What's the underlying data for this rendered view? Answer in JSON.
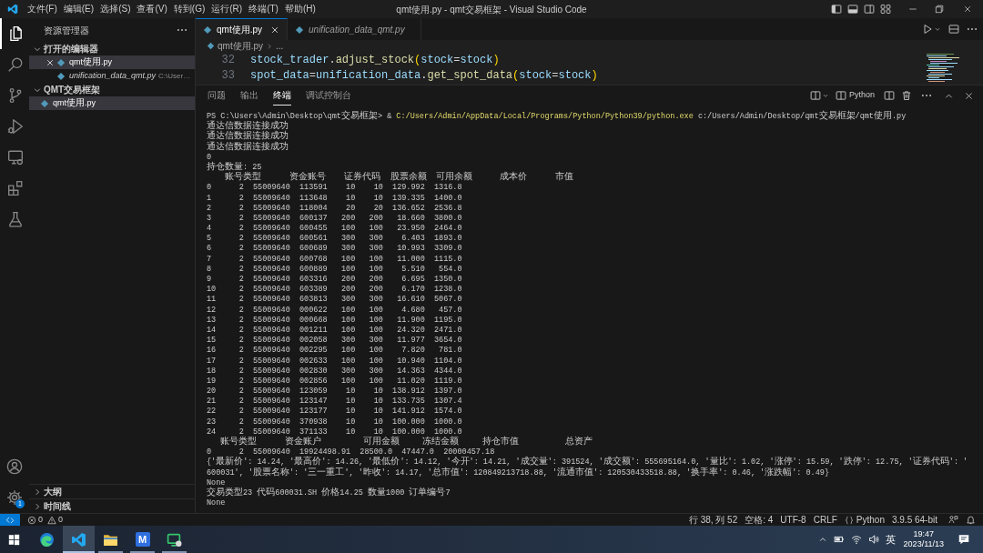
{
  "title_bar": {
    "menu": [
      "文件(F)",
      "编辑(E)",
      "选择(S)",
      "查看(V)",
      "转到(G)",
      "运行(R)",
      "终端(T)",
      "帮助(H)"
    ],
    "title": "qmt使用.py - qmt交易框架 - Visual Studio Code",
    "layout_toggles": [
      {
        "kind": "sidebar",
        "on": true
      },
      {
        "kind": "panel",
        "on": true
      },
      {
        "kind": "secondary",
        "on": false
      },
      {
        "kind": "customize"
      }
    ]
  },
  "activity_bar": {
    "items": [
      {
        "kind": "explorer",
        "selected": true
      },
      {
        "kind": "search",
        "selected": false
      },
      {
        "kind": "source_control",
        "selected": false
      },
      {
        "kind": "run",
        "selected": false
      },
      {
        "kind": "remote",
        "selected": false
      },
      {
        "kind": "extensions",
        "selected": false
      },
      {
        "kind": "testing",
        "selected": false
      }
    ],
    "bottom": [
      {
        "kind": "account"
      },
      {
        "kind": "settings",
        "badge": "1"
      }
    ]
  },
  "sidebar": {
    "title": "资源管理器",
    "sections": [
      {
        "title": "打开的编辑器",
        "expanded": true,
        "items": [
          {
            "label": "qmt使用.py",
            "selected": true,
            "preview": false,
            "close": true
          },
          {
            "label": "unification_data_qmt.py",
            "description": "C:\\User…",
            "selected": false,
            "preview": true,
            "close": false
          }
        ]
      },
      {
        "title": "QMT交易框架",
        "expanded": true,
        "items": [
          {
            "label": "qmt使用.py",
            "selected": true,
            "preview": false
          }
        ]
      },
      {
        "title": "大纲",
        "expanded": false
      },
      {
        "title": "时间线",
        "expanded": false
      }
    ]
  },
  "editor": {
    "tabs": [
      {
        "label": "qmt使用.py",
        "selected": true,
        "preview": false
      },
      {
        "label": "unification_data_qmt.py",
        "selected": false,
        "preview": true
      }
    ],
    "breadcrumb": [
      "qmt使用.py",
      "..."
    ],
    "code": [
      {
        "number": "32",
        "tokens": [
          {
            "text": "stock_trader",
            "kind": "variable"
          },
          {
            "text": ".",
            "kind": "punctuation"
          },
          {
            "text": "adjust_stock",
            "kind": "function"
          },
          {
            "text": "(",
            "kind": "bracket"
          },
          {
            "text": "stock",
            "kind": "variable"
          },
          {
            "text": "=",
            "kind": "operator"
          },
          {
            "text": "stock",
            "kind": "variable"
          },
          {
            "text": ")",
            "kind": "bracket"
          }
        ]
      },
      {
        "number": "33",
        "tokens": [
          {
            "text": "spot_data",
            "kind": "variable"
          },
          {
            "text": "=",
            "kind": "operator"
          },
          {
            "text": "unification_data",
            "kind": "variable"
          },
          {
            "text": ".",
            "kind": "punctuation"
          },
          {
            "text": "get_spot_data",
            "kind": "function"
          },
          {
            "text": "(",
            "kind": "bracket"
          },
          {
            "text": "stock",
            "kind": "variable"
          },
          {
            "text": "=",
            "kind": "operator"
          },
          {
            "text": "stock",
            "kind": "variable"
          },
          {
            "text": ")",
            "kind": "bracket"
          }
        ]
      }
    ]
  },
  "panel": {
    "tabs": [
      {
        "label": "问题",
        "selected": false
      },
      {
        "label": "输出",
        "selected": false
      },
      {
        "label": "终端",
        "selected": true
      },
      {
        "label": "调试控制台",
        "selected": false
      }
    ],
    "terminal_label": "Python",
    "terminal": {
      "command": {
        "prompt": "PS C:\\Users\\Admin\\Desktop\\qmt交易框架>",
        "operator": "&",
        "executable": "C:/Users/Admin/AppData/Local/Programs/Python/Python39/python.exe",
        "argument": "c:/Users/Admin/Desktop/qmt交易框架/qmt使用.py"
      },
      "output": [
        "通达信数据连接成功",
        "通达信数据连接成功",
        "通达信数据连接成功",
        "0",
        "持仓数量: 25",
        "    账号类型      资金账号    证券代码  股票余额  可用余额      成本价      市值",
        "0      2  55009640  113591    10    10  129.992  1316.8",
        "1      2  55009640  113648    10    10  139.335  1400.0",
        "2      2  55009640  118004    20    20  136.652  2536.8",
        "3      2  55009640  600137   200   200   18.660  3800.0",
        "4      2  55009640  600455   100   100   23.950  2464.0",
        "5      2  55009640  600561   300   300    6.403  1893.0",
        "6      2  55009640  600689   300   300   10.993  3309.0",
        "7      2  55009640  600768   100   100   11.000  1115.0",
        "8      2  55009640  600889   100   100    5.510   554.0",
        "9      2  55009640  603316   200   200    6.695  1350.0",
        "10     2  55009640  603389   200   200    6.170  1238.0",
        "11     2  55009640  603813   300   300   16.610  5067.0",
        "12     2  55009640  000622   100   100    4.680   457.0",
        "13     2  55009640  000668   100   100   11.900  1195.0",
        "14     2  55009640  001211   100   100   24.320  2471.0",
        "15     2  55009640  002058   300   300   11.977  3654.0",
        "16     2  55009640  002295   100   100    7.820   781.0",
        "17     2  55009640  002633   100   100   10.940  1104.0",
        "18     2  55009640  002830   300   300   14.363  4344.0",
        "19     2  55009640  002856   100   100   11.020  1119.0",
        "20     2  55009640  123059    10    10  138.912  1397.0",
        "21     2  55009640  123147    10    10  133.735  1307.4",
        "22     2  55009640  123177    10    10  141.912  1574.0",
        "23     2  55009640  370938    10    10  100.000  1000.0",
        "24     2  55009640  371133    10    10  100.000  1000.0",
        "   账号类型      资金账户         可用金额     冻结金额     持仓市值          总资产",
        "0      2  55009640  19924498.91  28500.0  47447.0  20000457.18",
        "{'最新价': 14.24, '最高价': 14.26, '最低价': 14.12, '今开': 14.21, '成交量': 391524, '成交额': 555695164.0, '量比': 1.02, '涨停': 15.59, '跌停': 12.75, '证券代码': '",
        "600031', '股票名称': '三一重工', '昨收': 14.17, '总市值': 120849213718.88, '流通市值': 120530433518.88, '换手率': 0.46, '涨跌幅': 0.49}",
        "None",
        "交易类型23 代码600031.SH 价格14.25 数量1000 订单编号7",
        "None"
      ]
    }
  },
  "status_bar": {
    "errors": "0",
    "warnings": "0",
    "items": [
      {
        "kind": "text",
        "text": "行 38, 列 52"
      },
      {
        "kind": "text",
        "text": "空格: 4"
      },
      {
        "kind": "text",
        "text": "UTF-8"
      },
      {
        "kind": "text",
        "text": "CRLF"
      },
      {
        "kind": "language",
        "text": "Python"
      },
      {
        "kind": "text",
        "text": "3.9.5 64-bit"
      }
    ]
  },
  "taskbar": {
    "apps": [
      {
        "kind": "browser",
        "running": false,
        "selected": false
      },
      {
        "kind": "code_editor",
        "running": true,
        "selected": true
      },
      {
        "kind": "folder",
        "running": true,
        "selected": false
      },
      {
        "kind": "letter_tile",
        "glyph": "M",
        "running": true,
        "selected": false
      },
      {
        "kind": "monitor",
        "running": true,
        "selected": false
      }
    ],
    "input_method": "英",
    "time": "19:47",
    "date": "2023/11/13"
  }
}
